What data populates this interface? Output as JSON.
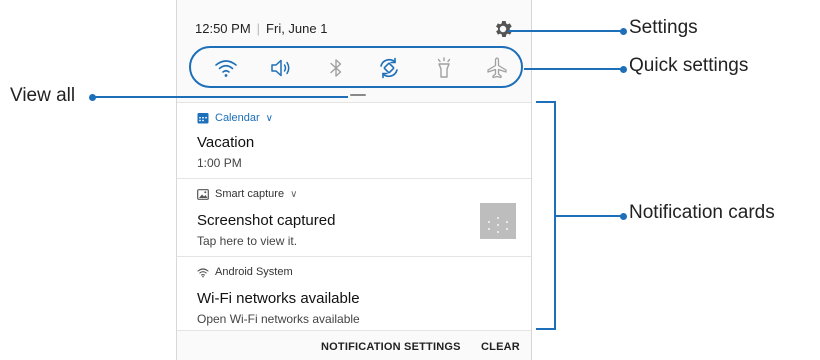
{
  "status_bar": {
    "time": "12:50 PM",
    "date": "Fri, June 1"
  },
  "header": {
    "settings_icon": "gear-icon"
  },
  "quick_settings": {
    "tiles": [
      {
        "name": "wifi",
        "icon": "wifi-icon"
      },
      {
        "name": "sound",
        "icon": "speaker-icon"
      },
      {
        "name": "bluetooth",
        "icon": "bluetooth-icon"
      },
      {
        "name": "auto-rotate",
        "icon": "rotate-icon"
      },
      {
        "name": "flashlight",
        "icon": "flashlight-icon"
      },
      {
        "name": "airplane-mode",
        "icon": "airplane-icon"
      }
    ]
  },
  "notifications": [
    {
      "app": "Calendar",
      "app_icon": "calendar-icon",
      "title": "Vacation",
      "text": "1:00 PM"
    },
    {
      "app": "Smart capture",
      "app_icon": "image-icon",
      "title": "Screenshot captured",
      "text": "Tap here to view it."
    },
    {
      "app": "Android System",
      "app_icon": "wifi-icon",
      "title": "Wi-Fi networks available",
      "text": "Open Wi-Fi networks available"
    }
  ],
  "footer": {
    "settings_label": "NOTIFICATION SETTINGS",
    "clear_label": "CLEAR"
  },
  "callouts": {
    "settings": "Settings",
    "quick_settings": "Quick settings",
    "view_all": "View all",
    "notification_cards": "Notification cards"
  },
  "colors": {
    "accent": "#1c6fb8",
    "background": "#fafafa"
  }
}
